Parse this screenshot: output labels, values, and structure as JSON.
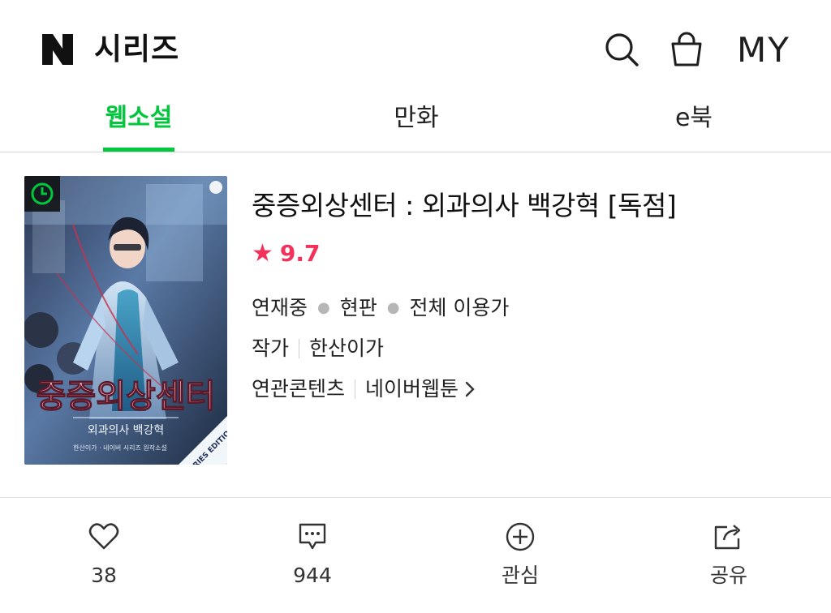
{
  "header": {
    "logo_letter": "N",
    "app_name": "시리즈",
    "my_label": "MY"
  },
  "tabs": [
    {
      "label": "웹소설",
      "active": true
    },
    {
      "label": "만화",
      "active": false
    },
    {
      "label": "e북",
      "active": false
    }
  ],
  "work": {
    "cover": {
      "title_art": "중증외상센터",
      "subtitle_art": "외과의사 백강혁",
      "credit_art": "한산이가 · 네이버 시리즈 원작소설",
      "edition_badge": "SERIES EDITION"
    },
    "title": "중증외상센터 : 외과의사 백강혁 [독점]",
    "rating_star": "★",
    "rating": "9.7",
    "status": "연재중",
    "format": "현판",
    "age": "전체 이용가",
    "author_label": "작가",
    "author": "한산이가",
    "related_label": "연관콘텐츠",
    "related_value": "네이버웹툰"
  },
  "actions": {
    "like_count": "38",
    "comment_count": "944",
    "favorite_label": "관심",
    "share_label": "공유"
  },
  "colors": {
    "accent_green": "#00c73c",
    "rating_pink": "#f3315a",
    "text": "#1e1e1e",
    "divider": "#d6d6d6"
  },
  "icons": {
    "search": "search-icon",
    "cart": "shopping-bag-icon",
    "like": "heart-icon",
    "comment": "comment-icon",
    "favorite": "plus-circle-icon",
    "share": "share-icon",
    "related": "chevron-right-icon"
  }
}
